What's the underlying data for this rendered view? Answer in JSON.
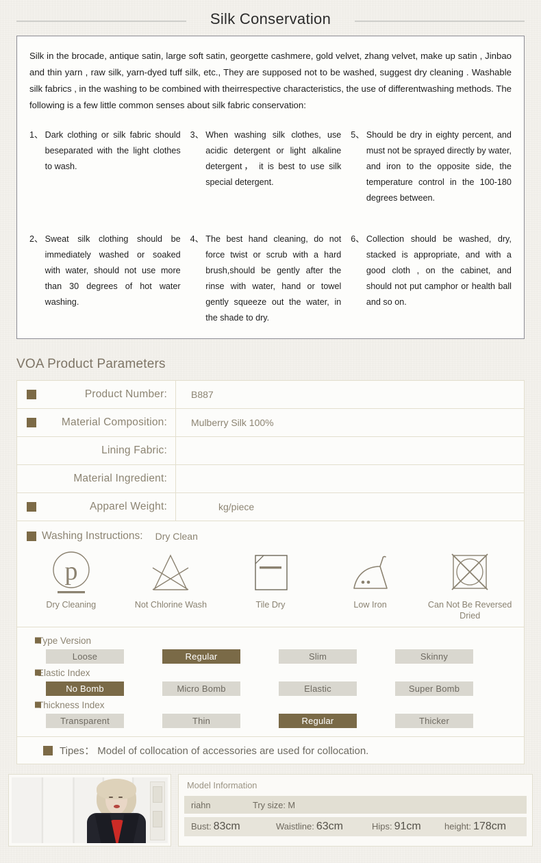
{
  "header": {
    "title": "Silk Conservation"
  },
  "conservation": {
    "intro": "Silk in the brocade, antique satin, large soft satin, georgette cashmere, gold velvet, zhang velvet, make up satin , Jinbao and thin yarn , raw silk, yarn-dyed tuff silk, etc., They are supposed not to be washed, suggest dry cleaning . Washable silk fabrics , in the washing to be combined with theirrespective characteristics, the use of differentwashing methods. The following is a few little common senses about silk fabric conservation:",
    "items": [
      {
        "num": "1、",
        "text": "Dark clothing or silk fabric should beseparated with the light clothes to wash."
      },
      {
        "num": "2、",
        "text": "Sweat silk clothing should be immediately washed or soaked with water, should not use more than 30 degrees of hot water washing."
      },
      {
        "num": "3、",
        "text": "When washing silk clothes, use acidic detergent or light alkaline detergent， it is best to use silk special detergent."
      },
      {
        "num": "4、",
        "text": "The best hand cleaning, do not force twist or scrub with a hard brush,should be gently after the rinse with water, hand or towel gently squeeze out the water, in the shade to dry."
      },
      {
        "num": "5、",
        "text": "Should be dry in eighty percent, and must not be sprayed directly by water, and iron to the opposite side, the temperature control in the 100-180 degrees between."
      },
      {
        "num": "6、",
        "text": "Collection should be washed, dry, stacked is appropriate, and with a good cloth , on the cabinet, and should not put camphor or health ball and so on."
      }
    ]
  },
  "parameters": {
    "section_title": "VOA Product Parameters",
    "rows": [
      {
        "label": "Product Number:",
        "value": "B887",
        "has_marker": true
      },
      {
        "label": "Material Composition:",
        "value": "Mulberry Silk 100%",
        "has_marker": true
      },
      {
        "label": "Lining Fabric:",
        "value": "",
        "has_marker": false
      },
      {
        "label": "Material Ingredient:",
        "value": "",
        "has_marker": false
      },
      {
        "label": "Apparel Weight:",
        "value": "kg/piece",
        "has_marker": true
      }
    ]
  },
  "washing": {
    "label": "Washing Instructions:",
    "value": "Dry Clean",
    "icons": [
      {
        "icon": "dry-cleaning-icon",
        "caption": "Dry Cleaning"
      },
      {
        "icon": "not-chlorine-wash-icon",
        "caption": "Not Chlorine Wash"
      },
      {
        "icon": "tile-dry-icon",
        "caption": "Tile Dry"
      },
      {
        "icon": "low-iron-icon",
        "caption": "Low Iron"
      },
      {
        "icon": "no-tumble-dry-icon",
        "caption": "Can Not Be Reversed Dried"
      }
    ]
  },
  "options": {
    "groups": [
      {
        "title": "Type  Version",
        "choices": [
          {
            "label": "Loose",
            "active": false
          },
          {
            "label": "Regular",
            "active": true
          },
          {
            "label": "Slim",
            "active": false
          },
          {
            "label": "Skinny",
            "active": false
          }
        ]
      },
      {
        "title": "Elastic Index",
        "choices": [
          {
            "label": "No  Bomb",
            "active": true
          },
          {
            "label": "Micro  Bomb",
            "active": false
          },
          {
            "label": "Elastic",
            "active": false
          },
          {
            "label": "Super  Bomb",
            "active": false
          }
        ]
      },
      {
        "title": "Thickness Index",
        "choices": [
          {
            "label": "Transparent",
            "active": false
          },
          {
            "label": "Thin",
            "active": false
          },
          {
            "label": "Regular",
            "active": true
          },
          {
            "label": "Thicker",
            "active": false
          }
        ]
      }
    ]
  },
  "tipes": {
    "text": "Tipes： Model of collocation of accessories are used for collocation."
  },
  "model": {
    "info_title": "Model Information",
    "name": "riahn",
    "try_size": "Try size: M",
    "stats": [
      {
        "key": "Bust:",
        "value": "83cm"
      },
      {
        "key": "Waistline:",
        "value": "63cm"
      },
      {
        "key": "Hips:",
        "value": "91cm"
      },
      {
        "key": "height:",
        "value": "178cm"
      }
    ]
  },
  "colors": {
    "accent_brown": "#7c6a46",
    "label_text": "#8c8472",
    "pill_inactive": "#d9d7cf",
    "pill_active": "#7a6a47",
    "border": "#e3dfce",
    "page_bg": "#f3f1ec"
  }
}
